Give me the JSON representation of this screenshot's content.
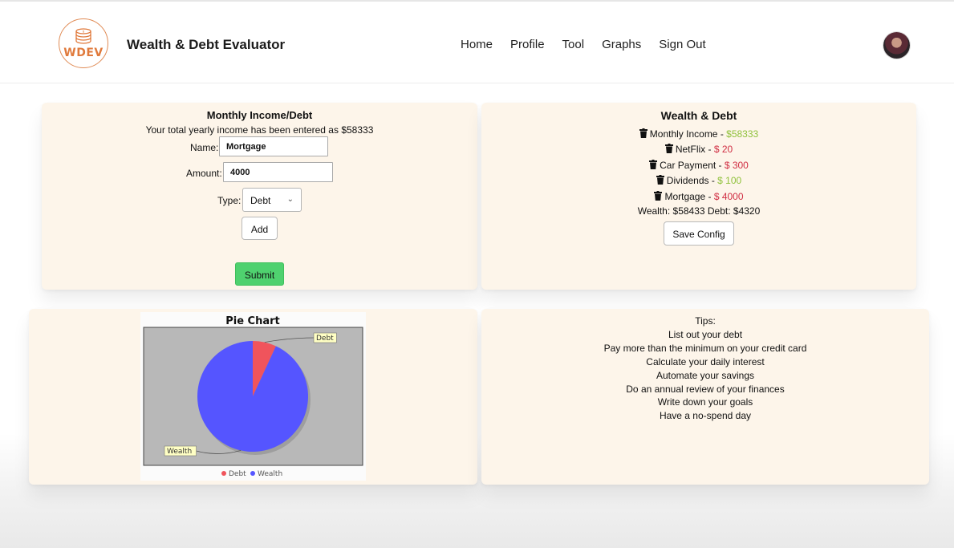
{
  "app": {
    "logo_text": "WDEV",
    "title": "Wealth & Debt Evaluator"
  },
  "nav": [
    {
      "label": "Home"
    },
    {
      "label": "Profile"
    },
    {
      "label": "Tool"
    },
    {
      "label": "Graphs"
    },
    {
      "label": "Sign Out"
    }
  ],
  "income_form": {
    "title": "Monthly Income/Debt",
    "subtitle": "Your total yearly income has been entered as $58333",
    "name_label": "Name:",
    "name_value": "Mortgage",
    "amount_label": "Amount:",
    "amount_value": "4000",
    "type_label": "Type:",
    "type_value": "Debt",
    "add_label": "Add",
    "submit_label": "Submit"
  },
  "wealth_panel": {
    "title": "Wealth & Debt",
    "items": [
      {
        "name": "Monthly Income",
        "sep": " - ",
        "value": "$58333",
        "kind": "income"
      },
      {
        "name": "NetFlix",
        "sep": " - ",
        "value": "$ 20",
        "kind": "debt"
      },
      {
        "name": "Car Payment",
        "sep": " - ",
        "value": "$ 300",
        "kind": "debt"
      },
      {
        "name": "Dividends",
        "sep": " - ",
        "value": "$ 100",
        "kind": "income"
      },
      {
        "name": "Mortgage",
        "sep": " - ",
        "value": "$ 4000",
        "kind": "debt"
      }
    ],
    "totals": "Wealth: $58433 Debt: $4320",
    "save_label": "Save Config"
  },
  "tips": {
    "title": "Tips:",
    "items": [
      "List out your debt",
      "Pay more than the minimum on your credit card",
      "Calculate your daily interest",
      "Automate your savings",
      "Do an annual review of your finances",
      "Write down your goals",
      "Have a no-spend day"
    ]
  },
  "colors": {
    "debt": "#f0545c",
    "wealth": "#5555ff",
    "income_text": "#8fc13a",
    "debt_text": "#d02e43",
    "submit": "#4fd16f",
    "card_bg": "#fdf5ea"
  },
  "chart_data": {
    "type": "pie",
    "title": "Pie Chart",
    "categories": [
      "Debt",
      "Wealth"
    ],
    "values": [
      4320,
      58433
    ],
    "colors": [
      "#f0545c",
      "#5555ff"
    ],
    "legend": "bottom"
  }
}
